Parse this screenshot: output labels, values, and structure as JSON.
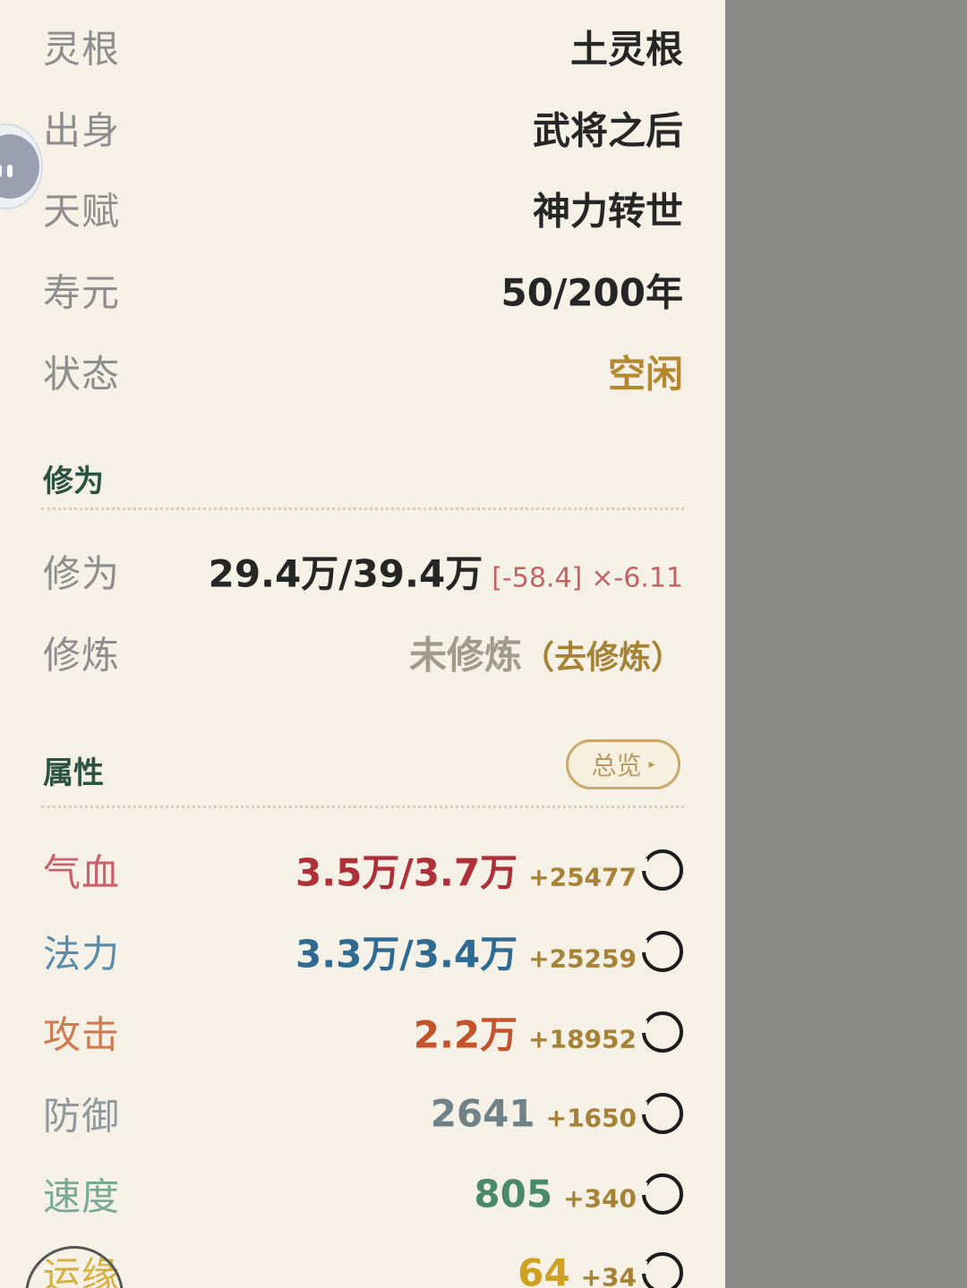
{
  "basic": [
    {
      "label": "灵根",
      "value": "土灵根"
    },
    {
      "label": "出身",
      "value": "武将之后"
    },
    {
      "label": "天赋",
      "value": "神力转世"
    },
    {
      "label": "寿元",
      "value": "50/200年"
    },
    {
      "label": "状态",
      "value": "空闲"
    }
  ],
  "cultivation_section": {
    "title": "修为",
    "progress": {
      "label": "修为",
      "value": "29.4万/39.4万",
      "bracket": "[-58.4]",
      "multiplier": "×-6.11"
    },
    "training": {
      "label": "修炼",
      "value": "未修炼",
      "link": "（去修炼）"
    }
  },
  "attributes_section": {
    "title": "属性",
    "overview_button": {
      "label": "总览",
      "arrow": "▸"
    },
    "items": [
      {
        "label": "气血",
        "value": "3.5万/3.7万",
        "bonus": "+25477"
      },
      {
        "label": "法力",
        "value": "3.3万/3.4万",
        "bonus": "+25259"
      },
      {
        "label": "攻击",
        "value": "2.2万",
        "bonus": "+18952"
      },
      {
        "label": "防御",
        "value": "2641",
        "bonus": "+1650"
      },
      {
        "label": "速度",
        "value": "805",
        "bonus": "+340"
      },
      {
        "label": "运缘",
        "value": "64",
        "bonus": "+34"
      }
    ]
  },
  "colors": {
    "panel_bg": "#f6f1e6",
    "side_bg": "#8a8a86",
    "section_title": "#2c5242",
    "status": "#b3882e",
    "hp": "#b0303a",
    "mp": "#2f6a92",
    "attack": "#c4522a",
    "defense": "#708188",
    "speed": "#4a8a6a",
    "luck": "#d0a020",
    "bonus": "#a68236"
  }
}
